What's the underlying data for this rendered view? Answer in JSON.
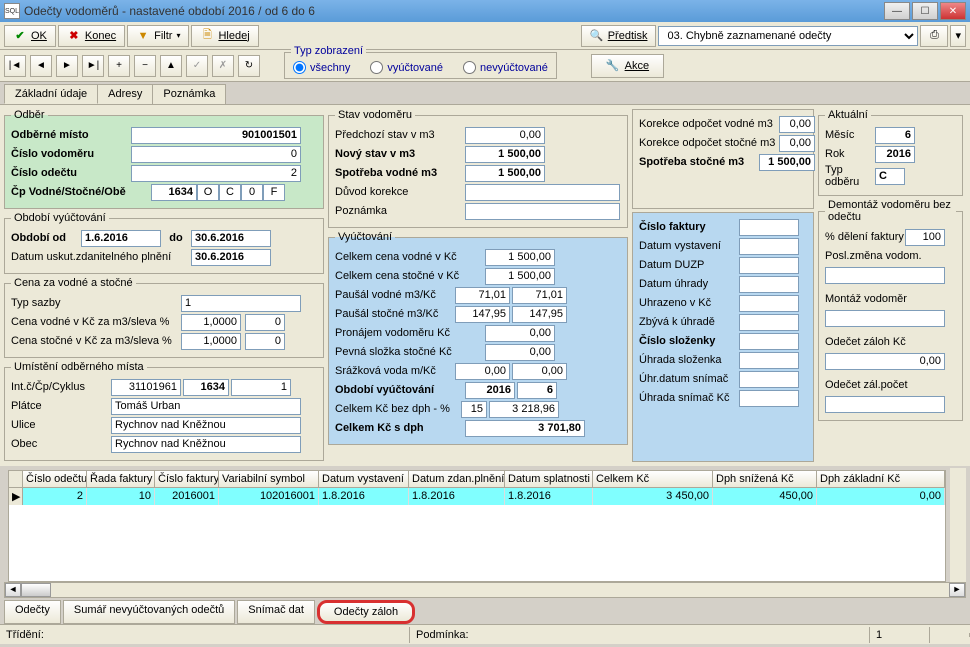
{
  "window": {
    "title": "Odečty vodoměrů - nastavené období 2016 / od 6 do 6",
    "icon_label": "SQL"
  },
  "toolbar": {
    "ok": "OK",
    "konec": "Konec",
    "filtr": "Filtr",
    "hledej": "Hledej",
    "predtisk": "Předtisk",
    "predtisk_select": "03. Chybně zaznamenané odečty",
    "akce": "Akce"
  },
  "typ_zobrazeni": {
    "legend": "Typ zobrazení",
    "vsechny": "všechny",
    "vyuctovane": "vyúčtované",
    "nevyuctovane": "nevyúčtované"
  },
  "tabs": {
    "zakladni": "Základní údaje",
    "adresy": "Adresy",
    "poznamka": "Poznámka"
  },
  "odber": {
    "legend": "Odběr",
    "odberne_misto_lbl": "Odběrné místo",
    "odberne_misto": "901001501",
    "cislo_vodomeru_lbl": "Číslo vodoměru",
    "cislo_vodomeru": "0",
    "cislo_odectu_lbl": "Číslo odečtu",
    "cislo_odectu": "2",
    "cp_lbl": "Čp Vodné/Stočné/Obě",
    "cp": "1634",
    "o": "O",
    "c": "C",
    "o2": "0",
    "f": "F"
  },
  "obdobi": {
    "legend": "Období vyúčtování",
    "od_lbl": "Období od",
    "od": "1.6.2016",
    "do_lbl": "do",
    "do": "30.6.2016",
    "datum_lbl": "Datum uskut.zdanitelného plnění",
    "datum": "30.6.2016"
  },
  "cena": {
    "legend": "Cena za vodné a stočné",
    "typ_sazby_lbl": "Typ sazby",
    "typ_sazby": "1",
    "vodne_lbl": "Cena vodné v Kč za m3/sleva %",
    "vodne": "1,0000",
    "vodne_sleva": "0",
    "stocne_lbl": "Cena stočné v Kč za m3/sleva %",
    "stocne": "1,0000",
    "stocne_sleva": "0"
  },
  "umisteni": {
    "legend": "Umístění odběrného místa",
    "int_lbl": "Int.č/Čp/Cyklus",
    "int": "31101961",
    "cp": "1634",
    "cyk": "1",
    "platce_lbl": "Plátce",
    "platce": "Tomáš Urban",
    "ulice_lbl": "Ulice",
    "ulice": "Rychnov nad Kněžnou",
    "obec_lbl": "Obec",
    "obec": "Rychnov nad Kněžnou"
  },
  "stav": {
    "legend": "Stav vodoměru",
    "predchozi_lbl": "Předchozí stav v m3",
    "predchozi": "0,00",
    "novy_lbl": "Nový stav v m3",
    "novy": "1 500,00",
    "spotreba_lbl": "Spotřeba vodné m3",
    "spotreba": "1 500,00",
    "duvod_lbl": "Důvod korekce",
    "poznamka_lbl": "Poznámka",
    "korekce_vodne_lbl": "Korekce odpočet vodné m3",
    "korekce_vodne": "0,00",
    "korekce_stocne_lbl": "Korekce odpočet stočné m3",
    "korekce_stocne": "0,00",
    "spotreba_stocne_lbl": "Spotřeba stočné m3",
    "spotreba_stocne": "1 500,00"
  },
  "vyuct": {
    "legend": "Vyúčtování",
    "celkem_vodne_lbl": "Celkem cena vodné v Kč",
    "celkem_vodne": "1 500,00",
    "celkem_stocne_lbl": "Celkem cena stočné v Kč",
    "celkem_stocne": "1 500,00",
    "pausal_vodne_lbl": "Paušál vodné m3/Kč",
    "pausal_vodne_m3": "71,01",
    "pausal_vodne_kc": "71,01",
    "pausal_stocne_lbl": "Paušál stočné m3/Kč",
    "pausal_stocne_m3": "147,95",
    "pausal_stocne_kc": "147,95",
    "pronajem_lbl": "Pronájem vodoměru Kč",
    "pronajem": "0,00",
    "pevna_lbl": "Pevná složka stočné Kč",
    "pevna": "0,00",
    "srazkova_lbl": "Srážková voda m/Kč",
    "srazkova_m": "0,00",
    "srazkova_kc": "0,00",
    "obdobi_lbl": "Období vyúčtování",
    "obdobi_rok": "2016",
    "obdobi_mes": "6",
    "bez_dph_lbl": "Celkem Kč bez dph  - %",
    "bez_dph_pct": "15",
    "bez_dph": "3 218,96",
    "s_dph_lbl": "Celkem Kč s dph",
    "s_dph": "3 701,80"
  },
  "faktura": {
    "cislo_lbl": "Číslo faktury",
    "datum_vyst_lbl": "Datum vystavení",
    "duzp_lbl": "Datum DUZP",
    "uhrady_lbl": "Datum úhrady",
    "uhrazeno_lbl": "Uhrazeno v Kč",
    "zbyva_lbl": "Zbývá k úhradě",
    "cislo_slozenky_lbl": "Číslo složenky",
    "uhrada_sloz_lbl": "Úhrada složenka",
    "uhr_snimac_lbl": "Úhr.datum snímač",
    "uhrada_snimac_lbl": "Úhrada snímač Kč"
  },
  "aktualni": {
    "legend": "Aktuální",
    "mesic_lbl": "Měsíc",
    "mesic": "6",
    "rok_lbl": "Rok",
    "rok": "2016",
    "typ_lbl": "Typ odběru",
    "typ": "C"
  },
  "demontaz": {
    "legend": "Demontáž vodoměru bez odečtu",
    "pct_lbl": "% dělení faktury",
    "pct": "100",
    "posl_lbl": "Posl.změna vodom.",
    "montaz_lbl": "Montáž vodoměr",
    "odecet_zaloh_lbl": "Odečet záloh Kč",
    "odecet_zaloh": "0,00",
    "odecet_pocet_lbl": "Odečet zál.počet"
  },
  "grid": {
    "headers": [
      "Číslo odečtu",
      "Řada faktury",
      "Číslo faktury",
      "Variabilní symbol",
      "Datum vystavení",
      "Datum zdan.plnění",
      "Datum splatnosti",
      "Celkem Kč",
      "Dph snížená Kč",
      "Dph základní Kč"
    ],
    "rows": [
      [
        "2",
        "10",
        "2016001",
        "102016001",
        "1.8.2016",
        "1.8.2016",
        "1.8.2016",
        "3 450,00",
        "450,00",
        "0,00"
      ]
    ]
  },
  "bottom_tabs": {
    "odecty": "Odečty",
    "sumar": "Sumář nevyúčtovaných odečtů",
    "snimac": "Snímač dat",
    "odecty_zaloh": "Odečty záloh"
  },
  "statusbar": {
    "trideni": "Třídění:",
    "podminka": "Podmínka:",
    "num": "1"
  }
}
